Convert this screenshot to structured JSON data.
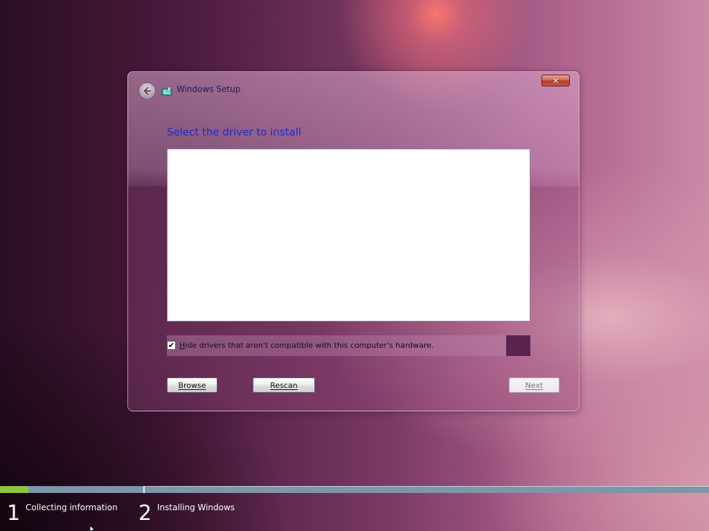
{
  "window": {
    "title": "Windows Setup",
    "close_label": "✕"
  },
  "page": {
    "heading": "Select the driver to install",
    "driver_list": []
  },
  "options": {
    "hide_incompatible": {
      "label_prefix": "H",
      "label_rest": "ide drivers that aren't compatible with this computer's hardware.",
      "checked": true
    }
  },
  "buttons": {
    "browse": "Browse",
    "rescan": "Rescan",
    "next": "Next"
  },
  "progress": {
    "step1_fraction": 0.2,
    "steps": [
      {
        "number": "1",
        "label": "Collecting information"
      },
      {
        "number": "2",
        "label": "Installing Windows"
      }
    ]
  },
  "colors": {
    "heading": "#1f2ac9",
    "progress_fill": "#8ec63f",
    "progress_track": "#7f95a8"
  }
}
